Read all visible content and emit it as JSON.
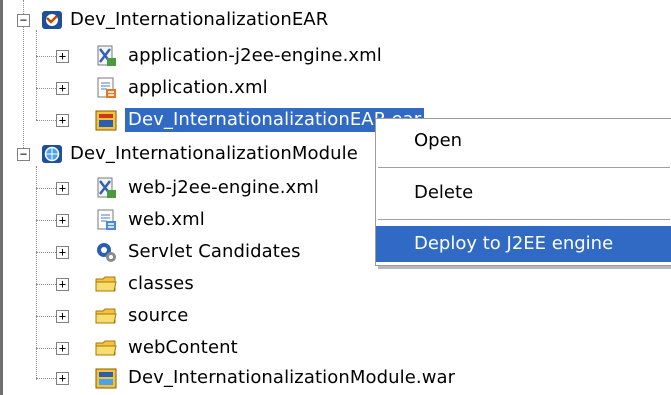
{
  "tree": {
    "items": [
      {
        "label": "Dev_InternationalizationEAR",
        "icon": "ear-project-icon",
        "toggle": "−"
      },
      {
        "label": "application-j2ee-engine.xml",
        "icon": "j2ee-xml-icon",
        "toggle": "+"
      },
      {
        "label": "application.xml",
        "icon": "xml-file-icon",
        "toggle": "+"
      },
      {
        "label": "Dev_InternationalizationEAR.ear",
        "icon": "ear-archive-icon",
        "toggle": "+"
      },
      {
        "label": "Dev_InternationalizationModule",
        "icon": "web-module-icon",
        "toggle": "−"
      },
      {
        "label": "web-j2ee-engine.xml",
        "icon": "j2ee-xml-icon",
        "toggle": "+"
      },
      {
        "label": "web.xml",
        "icon": "xml-file-icon",
        "toggle": "+"
      },
      {
        "label": "Servlet Candidates",
        "icon": "servlet-icon",
        "toggle": "+"
      },
      {
        "label": "classes",
        "icon": "folder-icon",
        "toggle": "+"
      },
      {
        "label": "source",
        "icon": "folder-icon",
        "toggle": "+"
      },
      {
        "label": "webContent",
        "icon": "folder-icon",
        "toggle": "+"
      },
      {
        "label": "Dev_InternationalizationModule.war",
        "icon": "war-archive-icon",
        "toggle": "+"
      }
    ]
  },
  "context_menu": {
    "items": [
      {
        "label": "Open"
      },
      {
        "label": "Delete"
      },
      {
        "label": "Deploy to J2EE engine"
      }
    ]
  },
  "colors": {
    "selection": "#316ac5",
    "selection_text": "#ffffff",
    "text": "#000000"
  }
}
